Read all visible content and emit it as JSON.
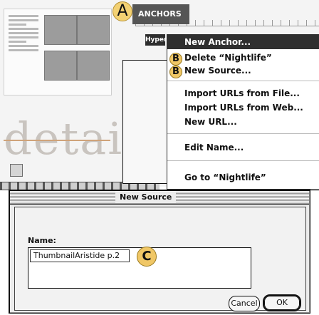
{
  "background": {
    "details_word": "details",
    "anchor_toolbar_label": "ANCHORS"
  },
  "hyper_tag": "Hyper",
  "menu": {
    "items": [
      {
        "label": "New Anchor...",
        "highlighted": true
      },
      {
        "label": "Delete “Nightlife”",
        "highlighted": false,
        "badge": "B"
      },
      {
        "label": "New Source...",
        "highlighted": false,
        "badge": "B"
      },
      {
        "label": "Import URLs from File...",
        "highlighted": false
      },
      {
        "label": "Import URLs from Web...",
        "highlighted": false
      },
      {
        "label": "New URL...",
        "highlighted": false
      },
      {
        "label": "Edit Name...",
        "highlighted": false
      },
      {
        "label": "Go to “Nightlife”",
        "highlighted": false
      }
    ],
    "badges": {
      "A": "A",
      "B": "B"
    }
  },
  "dialog": {
    "title": "New Source",
    "name_label": "Name:",
    "name_value": "ThumbnailAristide p.2",
    "badge_c": "C",
    "cancel_label": "Cancel",
    "ok_label": "OK"
  },
  "colors": {
    "menu_highlight": "#2f2f2f",
    "badge_yellow": "#f0c766",
    "dialog_bg": "#ececec"
  }
}
